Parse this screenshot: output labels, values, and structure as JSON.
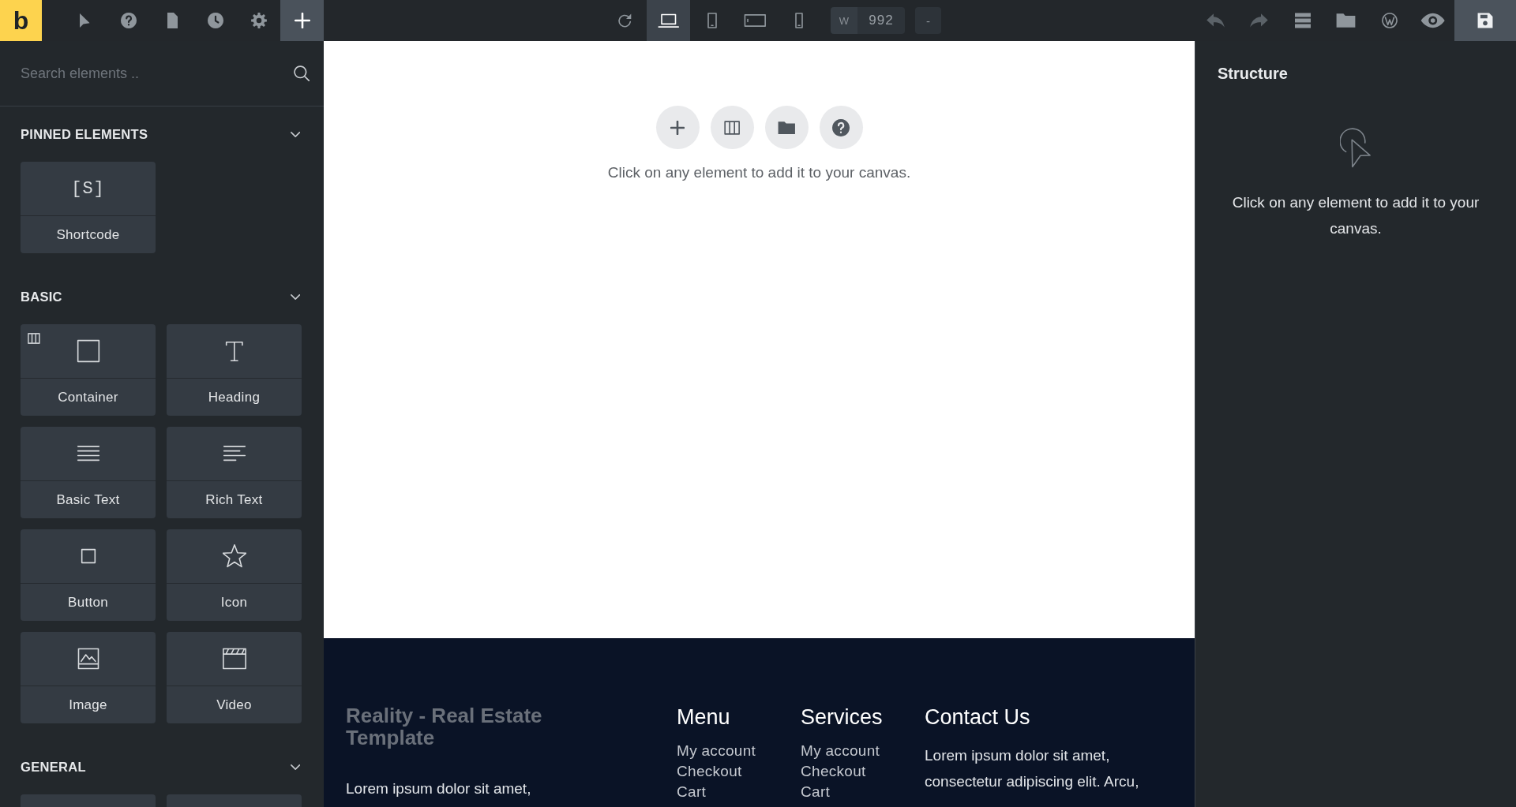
{
  "topbar": {
    "logo": "b",
    "left_tools": [
      {
        "kind": "cursor",
        "selected": false
      },
      {
        "kind": "help",
        "selected": false
      },
      {
        "kind": "page",
        "selected": false
      },
      {
        "kind": "clock",
        "selected": false
      },
      {
        "kind": "gear",
        "selected": false
      },
      {
        "kind": "plus",
        "selected": true
      }
    ],
    "view_tools": [
      {
        "kind": "refresh",
        "selected": false
      },
      {
        "kind": "laptop",
        "selected": true
      },
      {
        "kind": "tablet",
        "selected": false
      },
      {
        "kind": "tablet-landscape",
        "selected": false
      },
      {
        "kind": "phone",
        "selected": false
      }
    ],
    "width_field": {
      "label": "W",
      "value": "992"
    },
    "width_button": "-",
    "right_tools": [
      {
        "kind": "undo",
        "disabled": true,
        "highlighted": false
      },
      {
        "kind": "redo",
        "disabled": true,
        "highlighted": false
      },
      {
        "kind": "bars",
        "disabled": false,
        "highlighted": false
      },
      {
        "kind": "folder",
        "disabled": false,
        "highlighted": false
      },
      {
        "kind": "wordpress",
        "disabled": false,
        "highlighted": false
      },
      {
        "kind": "eye",
        "disabled": false,
        "highlighted": false
      },
      {
        "kind": "save",
        "disabled": false,
        "highlighted": true
      }
    ]
  },
  "sidebar": {
    "search": {
      "placeholder": "Search elements .."
    },
    "sections": [
      {
        "label": "PINNED ELEMENTS",
        "expanded": true,
        "elements": [
          {
            "label": "Shortcode",
            "kind": "shortcode",
            "glyph": "[S]",
            "nestable": false
          }
        ]
      },
      {
        "label": "BASIC",
        "expanded": true,
        "elements": [
          {
            "label": "Container",
            "kind": "container",
            "nestable": true
          },
          {
            "label": "Heading",
            "kind": "heading",
            "nestable": false
          },
          {
            "label": "Basic Text",
            "kind": "basic-text",
            "nestable": false
          },
          {
            "label": "Rich Text",
            "kind": "rich-text",
            "nestable": false
          },
          {
            "label": "Button",
            "kind": "button",
            "nestable": false
          },
          {
            "label": "Icon",
            "kind": "star",
            "nestable": false
          },
          {
            "label": "Image",
            "kind": "image",
            "nestable": false
          },
          {
            "label": "Video",
            "kind": "video",
            "nestable": false
          }
        ]
      },
      {
        "label": "GENERAL",
        "expanded": true,
        "elements": [
          {
            "nestable": false
          },
          {
            "nestable": false
          }
        ]
      }
    ]
  },
  "canvas": {
    "actions": [
      {
        "kind": "plus"
      },
      {
        "kind": "columns"
      },
      {
        "kind": "folder"
      },
      {
        "kind": "help"
      }
    ],
    "message": "Click on any element to add it to your canvas.",
    "footer": {
      "brand": "Reality - Real Estate Template",
      "intro": "Lorem ipsum dolor sit amet,",
      "columns": [
        {
          "title": "Menu",
          "links": [
            "My account",
            "Checkout",
            "Cart"
          ]
        },
        {
          "title": "Services",
          "links": [
            "My account",
            "Checkout",
            "Cart"
          ]
        }
      ],
      "contact": {
        "title": "Contact Us",
        "text": "Lorem ipsum dolor sit amet, consectetur adipiscing elit. Arcu,"
      }
    }
  },
  "structure": {
    "title": "Structure",
    "message": "Click on any element to add it to your canvas."
  }
}
